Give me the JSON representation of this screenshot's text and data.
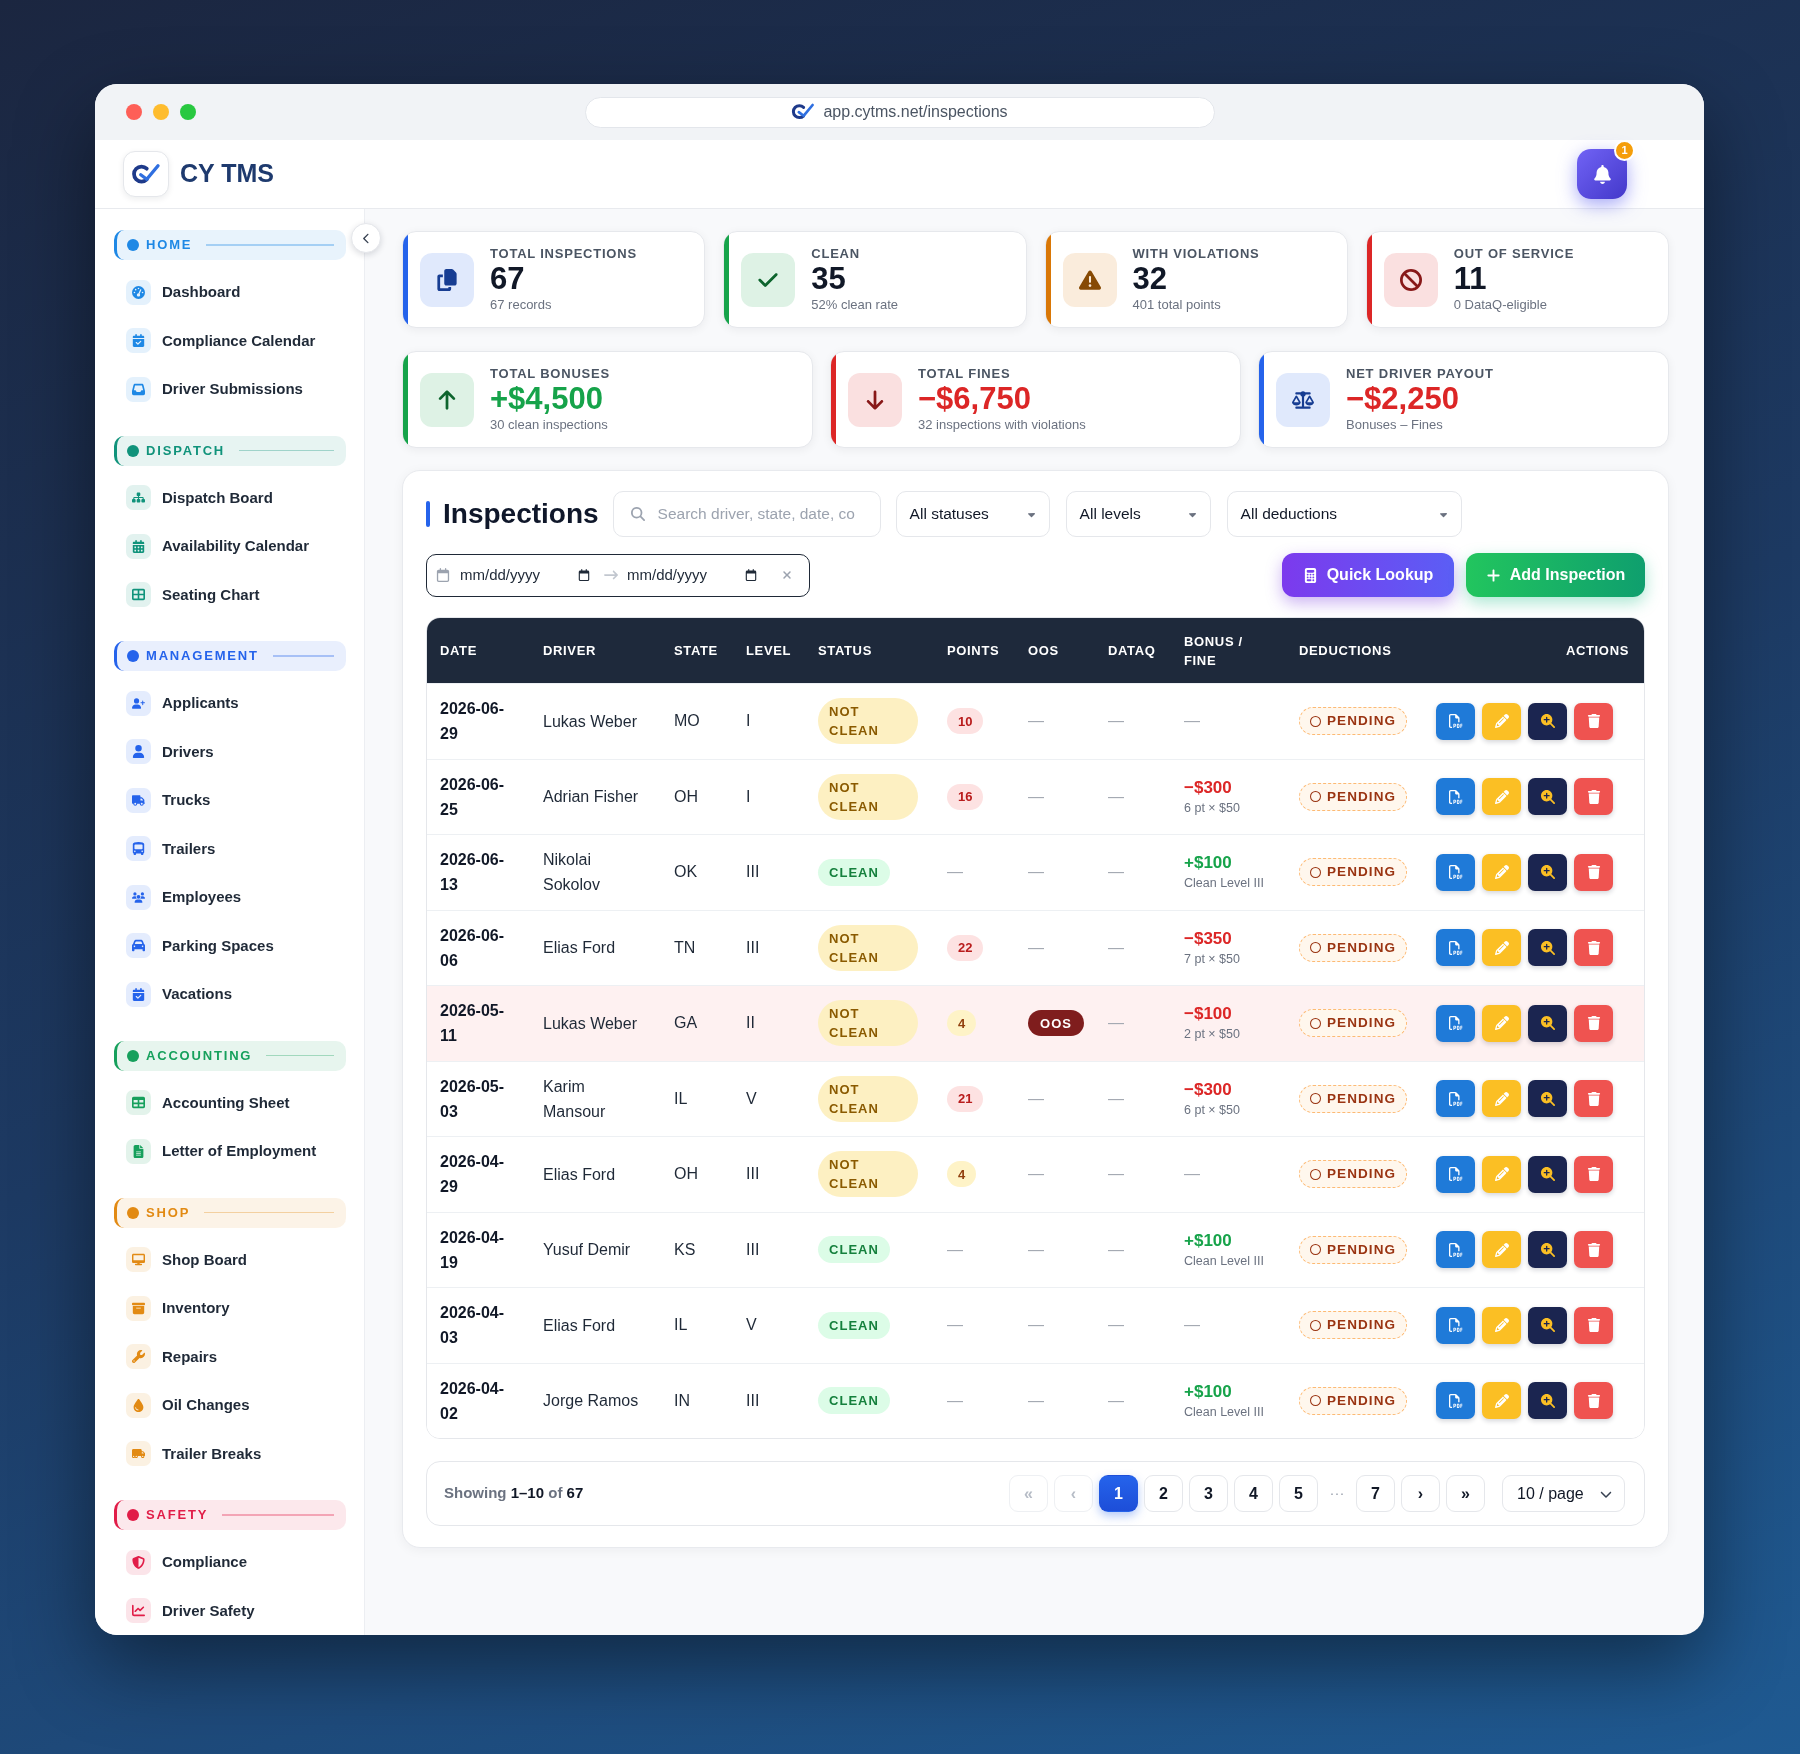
{
  "window": {
    "url": "app.cytms.net/inspections"
  },
  "header": {
    "brand": "CY TMS",
    "notifications": "1"
  },
  "sidebar": {
    "sections": [
      {
        "title": "HOME",
        "color": "#1e88e5",
        "items": [
          "Dashboard",
          "Compliance Calendar",
          "Driver Submissions"
        ]
      },
      {
        "title": "DISPATCH",
        "color": "#10937b",
        "items": [
          "Dispatch Board",
          "Availability Calendar",
          "Seating Chart"
        ]
      },
      {
        "title": "MANAGEMENT",
        "color": "#2563eb",
        "items": [
          "Applicants",
          "Drivers",
          "Trucks",
          "Trailers",
          "Employees",
          "Parking Spaces",
          "Vacations"
        ]
      },
      {
        "title": "ACCOUNTING",
        "color": "#16a05c",
        "items": [
          "Accounting Sheet",
          "Letter of Employment"
        ]
      },
      {
        "title": "SHOP",
        "color": "#e28a13",
        "items": [
          "Shop Board",
          "Inventory",
          "Repairs",
          "Oil Changes",
          "Trailer Breaks"
        ]
      },
      {
        "title": "SAFETY",
        "color": "#e11d48",
        "items": [
          "Compliance",
          "Driver Safety"
        ]
      }
    ]
  },
  "stats": [
    {
      "label": "TOTAL INSPECTIONS",
      "value": "67",
      "note": "67 records",
      "color": "#2563eb"
    },
    {
      "label": "CLEAN",
      "value": "35",
      "note": "52% clean rate",
      "color": "#16a34a"
    },
    {
      "label": "WITH VIOLATIONS",
      "value": "32",
      "note": "401 total points",
      "color": "#d97706"
    },
    {
      "label": "OUT OF SERVICE",
      "value": "11",
      "note": "0 DataQ-eligible",
      "color": "#dc2626"
    }
  ],
  "totals": [
    {
      "label": "TOTAL BONUSES",
      "value": "+$4,500",
      "note": "30 clean inspections",
      "color": "#16a34a",
      "negative": false
    },
    {
      "label": "TOTAL FINES",
      "value": "−$6,750",
      "note": "32 inspections with violations",
      "color": "#dc2626",
      "negative": true
    },
    {
      "label": "NET DRIVER PAYOUT",
      "value": "−$2,250",
      "note": "Bonuses – Fines",
      "color": "#2563eb",
      "negative": true
    }
  ],
  "inspections": {
    "title": "Inspections",
    "search": {
      "placeholder": "Search driver, state, date, co"
    },
    "filters": [
      {
        "value": "All statuses"
      },
      {
        "value": "All levels"
      },
      {
        "value": "All deductions"
      }
    ],
    "date_range": {
      "from": {
        "placeholder": "mm/dd/yyyy"
      },
      "to": {
        "placeholder": "mm/dd/yyyy"
      }
    },
    "buttons": [
      {
        "label": "Quick Lookup",
        "kind": "lookup"
      },
      {
        "label": "Add Inspection",
        "kind": "add"
      }
    ]
  },
  "table": {
    "columns": [
      "DATE",
      "DRIVER",
      "STATE",
      "LEVEL",
      "STATUS",
      "POINTS",
      "OOS",
      "DATAQ",
      "BONUS / FINE",
      "DEDUCTIONS",
      "ACTIONS"
    ],
    "rows": [
      {
        "date": "2026-06-29",
        "driver": "Lukas Weber",
        "state": "MO",
        "level": "I",
        "status": {
          "text": "NOT CLEAN",
          "clean": false
        },
        "points": {
          "text": "10",
          "high": true
        },
        "oos": {
          "text": "—",
          "flagged": false
        },
        "dataq": "—",
        "bonus_fine": {
          "amount": "—"
        },
        "deduction": "PENDING",
        "highlighted": false
      },
      {
        "date": "2026-06-25",
        "driver": "Adrian Fisher",
        "state": "OH",
        "level": "I",
        "status": {
          "text": "NOT CLEAN",
          "clean": false
        },
        "points": {
          "text": "16",
          "high": true
        },
        "oos": {
          "text": "—",
          "flagged": false
        },
        "dataq": "—",
        "bonus_fine": {
          "amount": "−$300",
          "note": "6 pt × $50",
          "bonus": false
        },
        "deduction": "PENDING",
        "highlighted": false
      },
      {
        "date": "2026-06-13",
        "driver": "Nikolai Sokolov",
        "state": "OK",
        "level": "III",
        "status": {
          "text": "CLEAN",
          "clean": true
        },
        "points": {
          "text": "—"
        },
        "oos": {
          "text": "—",
          "flagged": false
        },
        "dataq": "—",
        "bonus_fine": {
          "amount": "+$100",
          "note": "Clean Level III",
          "bonus": true
        },
        "deduction": "PENDING",
        "highlighted": false
      },
      {
        "date": "2026-06-06",
        "driver": "Elias Ford",
        "state": "TN",
        "level": "III",
        "status": {
          "text": "NOT CLEAN",
          "clean": false
        },
        "points": {
          "text": "22",
          "high": true
        },
        "oos": {
          "text": "—",
          "flagged": false
        },
        "dataq": "—",
        "bonus_fine": {
          "amount": "−$350",
          "note": "7 pt × $50",
          "bonus": false
        },
        "deduction": "PENDING",
        "highlighted": false
      },
      {
        "date": "2026-05-11",
        "driver": "Lukas Weber",
        "state": "GA",
        "level": "II",
        "status": {
          "text": "NOT CLEAN",
          "clean": false
        },
        "points": {
          "text": "4",
          "high": false
        },
        "oos": {
          "text": "OOS",
          "flagged": true
        },
        "dataq": "—",
        "bonus_fine": {
          "amount": "−$100",
          "note": "2 pt × $50",
          "bonus": false
        },
        "deduction": "PENDING",
        "highlighted": true
      },
      {
        "date": "2026-05-03",
        "driver": "Karim Mansour",
        "state": "IL",
        "level": "V",
        "status": {
          "text": "NOT CLEAN",
          "clean": false
        },
        "points": {
          "text": "21",
          "high": true
        },
        "oos": {
          "text": "—",
          "flagged": false
        },
        "dataq": "—",
        "bonus_fine": {
          "amount": "−$300",
          "note": "6 pt × $50",
          "bonus": false
        },
        "deduction": "PENDING",
        "highlighted": false
      },
      {
        "date": "2026-04-29",
        "driver": "Elias Ford",
        "state": "OH",
        "level": "III",
        "status": {
          "text": "NOT CLEAN",
          "clean": false
        },
        "points": {
          "text": "4",
          "high": false
        },
        "oos": {
          "text": "—",
          "flagged": false
        },
        "dataq": "—",
        "bonus_fine": {
          "amount": "—"
        },
        "deduction": "PENDING",
        "highlighted": false
      },
      {
        "date": "2026-04-19",
        "driver": "Yusuf Demir",
        "state": "KS",
        "level": "III",
        "status": {
          "text": "CLEAN",
          "clean": true
        },
        "points": {
          "text": "—"
        },
        "oos": {
          "text": "—",
          "flagged": false
        },
        "dataq": "—",
        "bonus_fine": {
          "amount": "+$100",
          "note": "Clean Level III",
          "bonus": true
        },
        "deduction": "PENDING",
        "highlighted": false
      },
      {
        "date": "2026-04-03",
        "driver": "Elias Ford",
        "state": "IL",
        "level": "V",
        "status": {
          "text": "CLEAN",
          "clean": true
        },
        "points": {
          "text": "—"
        },
        "oos": {
          "text": "—",
          "flagged": false
        },
        "dataq": "—",
        "bonus_fine": {
          "amount": "—"
        },
        "deduction": "PENDING",
        "highlighted": false
      },
      {
        "date": "2026-04-02",
        "driver": "Jorge Ramos",
        "state": "IN",
        "level": "III",
        "status": {
          "text": "CLEAN",
          "clean": true
        },
        "points": {
          "text": "—"
        },
        "oos": {
          "text": "—",
          "flagged": false
        },
        "dataq": "—",
        "bonus_fine": {
          "amount": "+$100",
          "note": "Clean Level III",
          "bonus": true
        },
        "deduction": "PENDING",
        "highlighted": false
      }
    ]
  },
  "pagination": {
    "summary": "Showing **1–10** of **67**",
    "pages": [
      {
        "label": "«",
        "kind": "nav",
        "selected": false,
        "disabled": true
      },
      {
        "label": "‹",
        "kind": "nav",
        "selected": false,
        "disabled": true
      },
      {
        "label": "1",
        "kind": "page",
        "selected": true,
        "disabled": false
      },
      {
        "label": "2",
        "kind": "page",
        "selected": false,
        "disabled": false
      },
      {
        "label": "3",
        "kind": "page",
        "selected": false,
        "disabled": false
      },
      {
        "label": "4",
        "kind": "page",
        "selected": false,
        "disabled": false
      },
      {
        "label": "5",
        "kind": "page",
        "selected": false,
        "disabled": false
      },
      {
        "label": "···",
        "kind": "ellipsis"
      },
      {
        "label": "7",
        "kind": "page",
        "selected": false,
        "disabled": false
      },
      {
        "label": "›",
        "kind": "nav",
        "selected": false,
        "disabled": false
      },
      {
        "label": "»",
        "kind": "nav",
        "selected": false,
        "disabled": false
      }
    ],
    "page_size": "10 / page"
  }
}
